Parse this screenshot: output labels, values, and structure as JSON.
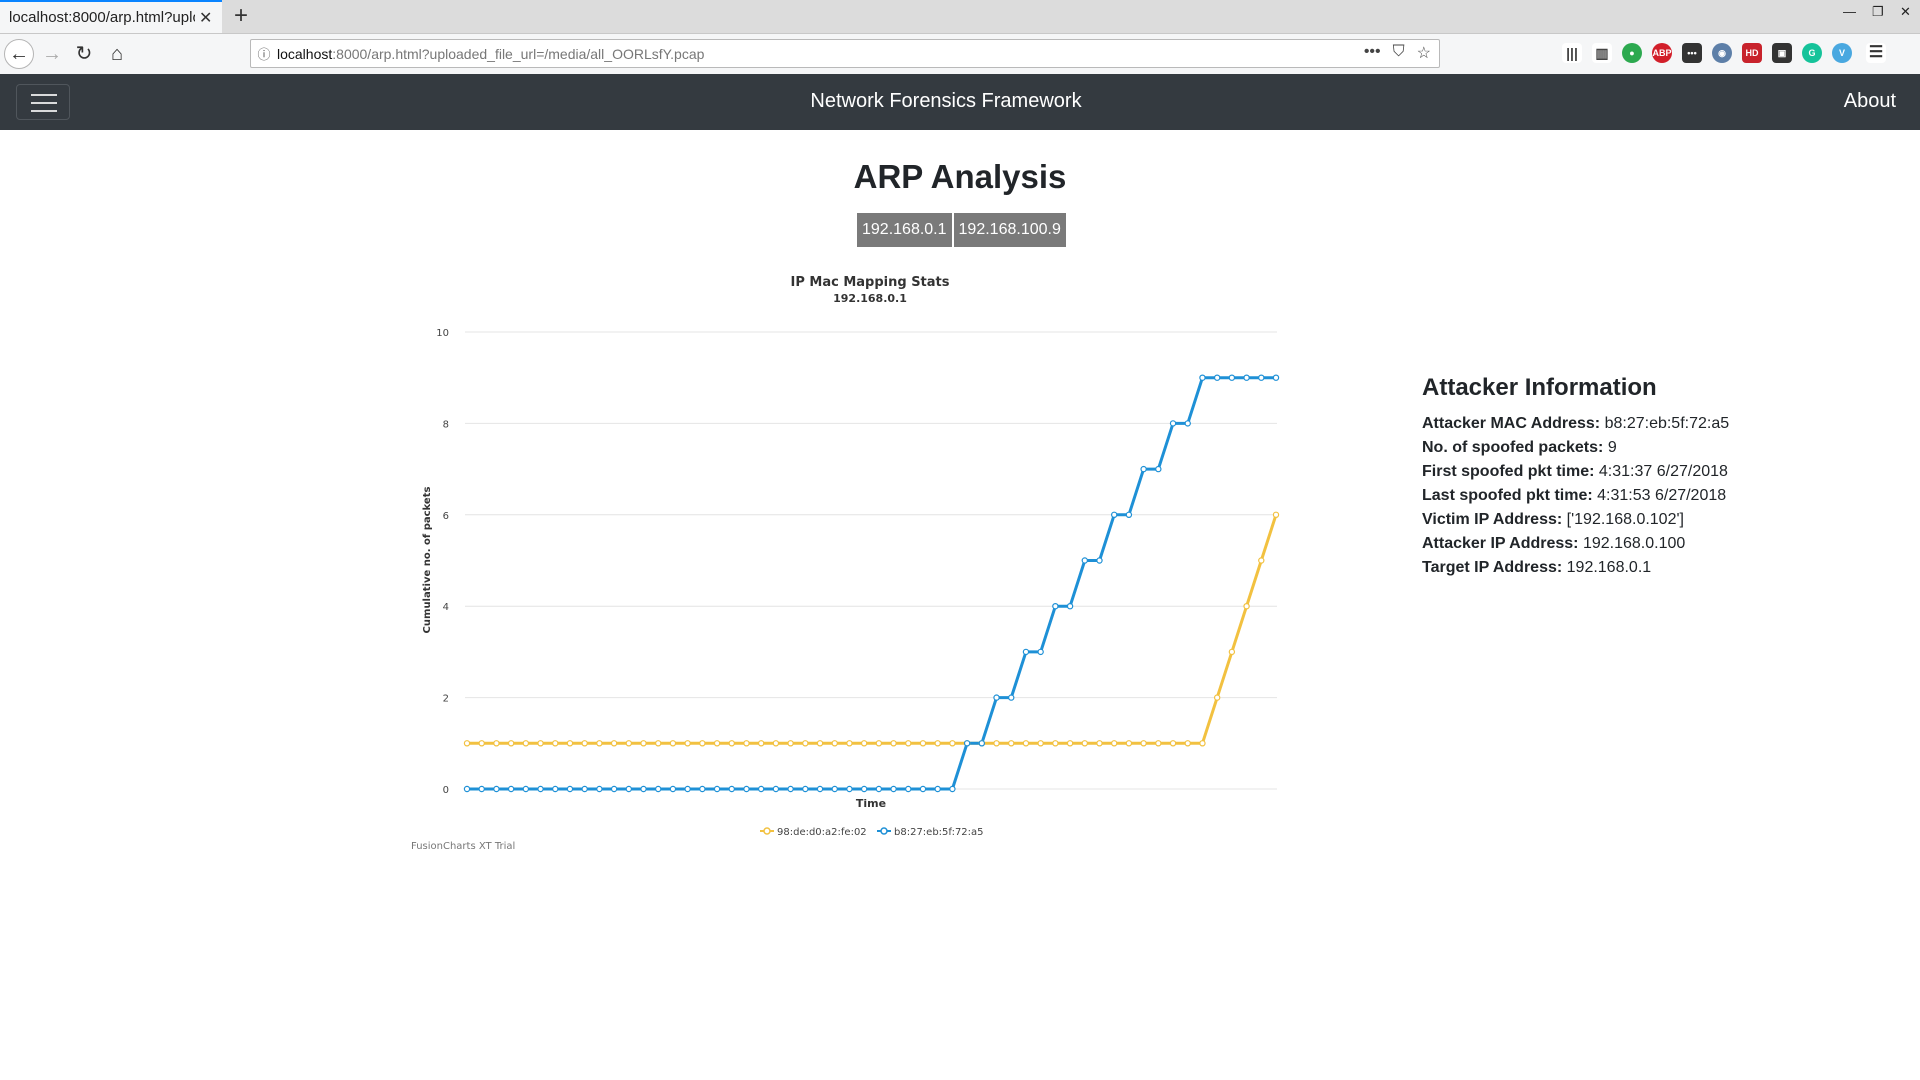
{
  "browser": {
    "tab_title": "localhost:8000/arp.html?uploaded_file_url=/media/all_OORLsfY.pcap",
    "url_host": "localhost",
    "url_rest": ":8000/arp.html?uploaded_file_url=/media/all_OORLsfY.pcap"
  },
  "appbar": {
    "brand": "Network Forensics Framework",
    "about": "About"
  },
  "page": {
    "title": "ARP Analysis",
    "ip_tabs": [
      "192.168.0.1",
      "192.168.100.9"
    ]
  },
  "chart_data": {
    "type": "line",
    "title": "IP Mac Mapping Stats",
    "subtitle": "192.168.0.1",
    "xlabel": "Time",
    "ylabel": "Cumulative no. of packets",
    "ylim": [
      0,
      10
    ],
    "yticks": [
      0,
      2,
      4,
      6,
      8,
      10
    ],
    "grid": true,
    "legend_position": "bottom",
    "series": [
      {
        "name": "98:de:d0:a2:fe:02",
        "color": "#f2c140",
        "values": [
          1,
          1,
          1,
          1,
          1,
          1,
          1,
          1,
          1,
          1,
          1,
          1,
          1,
          1,
          1,
          1,
          1,
          1,
          1,
          1,
          1,
          1,
          1,
          1,
          1,
          1,
          1,
          1,
          1,
          1,
          1,
          1,
          1,
          1,
          1,
          1,
          1,
          1,
          1,
          1,
          1,
          1,
          1,
          1,
          1,
          1,
          1,
          1,
          1,
          1,
          1,
          2,
          3,
          4,
          5,
          6
        ]
      },
      {
        "name": "b8:27:eb:5f:72:a5",
        "color": "#1e90d6",
        "values": [
          0,
          0,
          0,
          0,
          0,
          0,
          0,
          0,
          0,
          0,
          0,
          0,
          0,
          0,
          0,
          0,
          0,
          0,
          0,
          0,
          0,
          0,
          0,
          0,
          0,
          0,
          0,
          0,
          0,
          0,
          0,
          0,
          0,
          0,
          1,
          1,
          2,
          2,
          3,
          3,
          4,
          4,
          5,
          5,
          6,
          6,
          7,
          7,
          8,
          8,
          9,
          9,
          9,
          9,
          9,
          9
        ]
      }
    ],
    "watermark": "FusionCharts XT Trial"
  },
  "attacker": {
    "heading": "Attacker Information",
    "rows": [
      {
        "label": "Attacker MAC Address:",
        "value": "b8:27:eb:5f:72:a5"
      },
      {
        "label": "No. of spoofed packets:",
        "value": "9"
      },
      {
        "label": "First spoofed pkt time:",
        "value": "4:31:37 6/27/2018"
      },
      {
        "label": "Last spoofed pkt time:",
        "value": "4:31:53 6/27/2018"
      },
      {
        "label": "Victim IP Address:",
        "value": "['192.168.0.102']"
      },
      {
        "label": "Attacker IP Address:",
        "value": "192.168.0.100"
      },
      {
        "label": "Target IP Address:",
        "value": "192.168.0.1"
      }
    ]
  }
}
